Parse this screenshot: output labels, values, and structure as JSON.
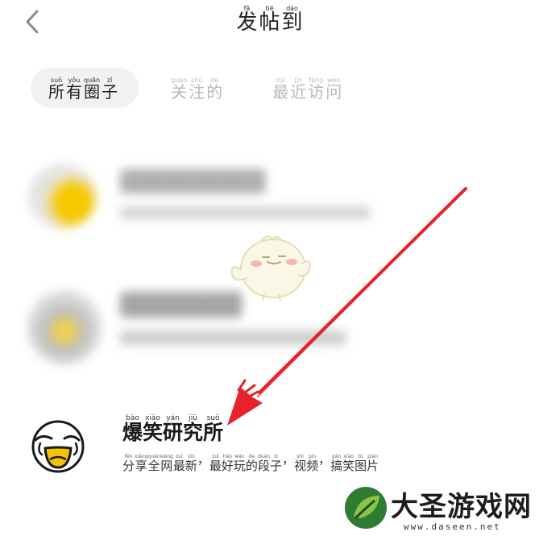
{
  "header": {
    "back_icon": "chevron-left-icon",
    "title": [
      {
        "p": "fā",
        "c": "发"
      },
      {
        "p": "tiē",
        "c": "帖"
      },
      {
        "p": "dào",
        "c": "到"
      }
    ]
  },
  "tabs": [
    {
      "id": "all",
      "active": true,
      "chars": [
        {
          "p": "suǒ",
          "c": "所"
        },
        {
          "p": "yǒu",
          "c": "有"
        },
        {
          "p": "quān",
          "c": "圈"
        },
        {
          "p": "zǐ",
          "c": "子"
        }
      ]
    },
    {
      "id": "follow",
      "active": false,
      "chars": [
        {
          "p": "guān",
          "c": "关"
        },
        {
          "p": "zhù",
          "c": "注"
        },
        {
          "p": "de",
          "c": "的"
        }
      ]
    },
    {
      "id": "recent",
      "active": false,
      "chars": [
        {
          "p": "zuì",
          "c": "最"
        },
        {
          "p": "jìn",
          "c": "近"
        },
        {
          "p": "fǎng",
          "c": "访"
        },
        {
          "p": "wèn",
          "c": "问"
        }
      ]
    }
  ],
  "community": {
    "avatar_icon": "laughing-face-icon",
    "name": [
      {
        "p": "bào",
        "c": "爆"
      },
      {
        "p": "xiào",
        "c": "笑"
      },
      {
        "p": "yán",
        "c": "研"
      },
      {
        "p": "jiū",
        "c": "究"
      },
      {
        "p": "suǒ",
        "c": "所"
      }
    ],
    "desc": [
      {
        "p": "fēn",
        "c": "分"
      },
      {
        "p": "xiǎng",
        "c": "享"
      },
      {
        "p": "quán",
        "c": "全"
      },
      {
        "p": "wǎng",
        "c": "网"
      },
      {
        "p": "zuì",
        "c": "最"
      },
      {
        "p": "xīn",
        "c": "新"
      },
      {
        "p": "",
        "c": "，"
      },
      {
        "p": "zuì",
        "c": "最"
      },
      {
        "p": "hǎo",
        "c": "好"
      },
      {
        "p": "wán",
        "c": "玩"
      },
      {
        "p": "de",
        "c": "的"
      },
      {
        "p": "duàn",
        "c": "段"
      },
      {
        "p": "zi",
        "c": "子"
      },
      {
        "p": "",
        "c": "，"
      },
      {
        "p": "shì",
        "c": "视"
      },
      {
        "p": "pín",
        "c": "频"
      },
      {
        "p": "",
        "c": "，"
      },
      {
        "p": "gǎo",
        "c": "搞"
      },
      {
        "p": "xiào",
        "c": "笑"
      },
      {
        "p": "tú",
        "c": "图"
      },
      {
        "p": "piàn",
        "c": "片"
      }
    ]
  },
  "watermark": {
    "text": "大圣游戏网",
    "url": "www.daseen.net",
    "logo_icon": "leaf-logo-icon"
  },
  "colors": {
    "arrow": "#e8222a",
    "active_tab_bg": "#f1f1f1",
    "inactive_tab_text": "#b9b9b9",
    "avatar_accent": "#f5c400"
  }
}
